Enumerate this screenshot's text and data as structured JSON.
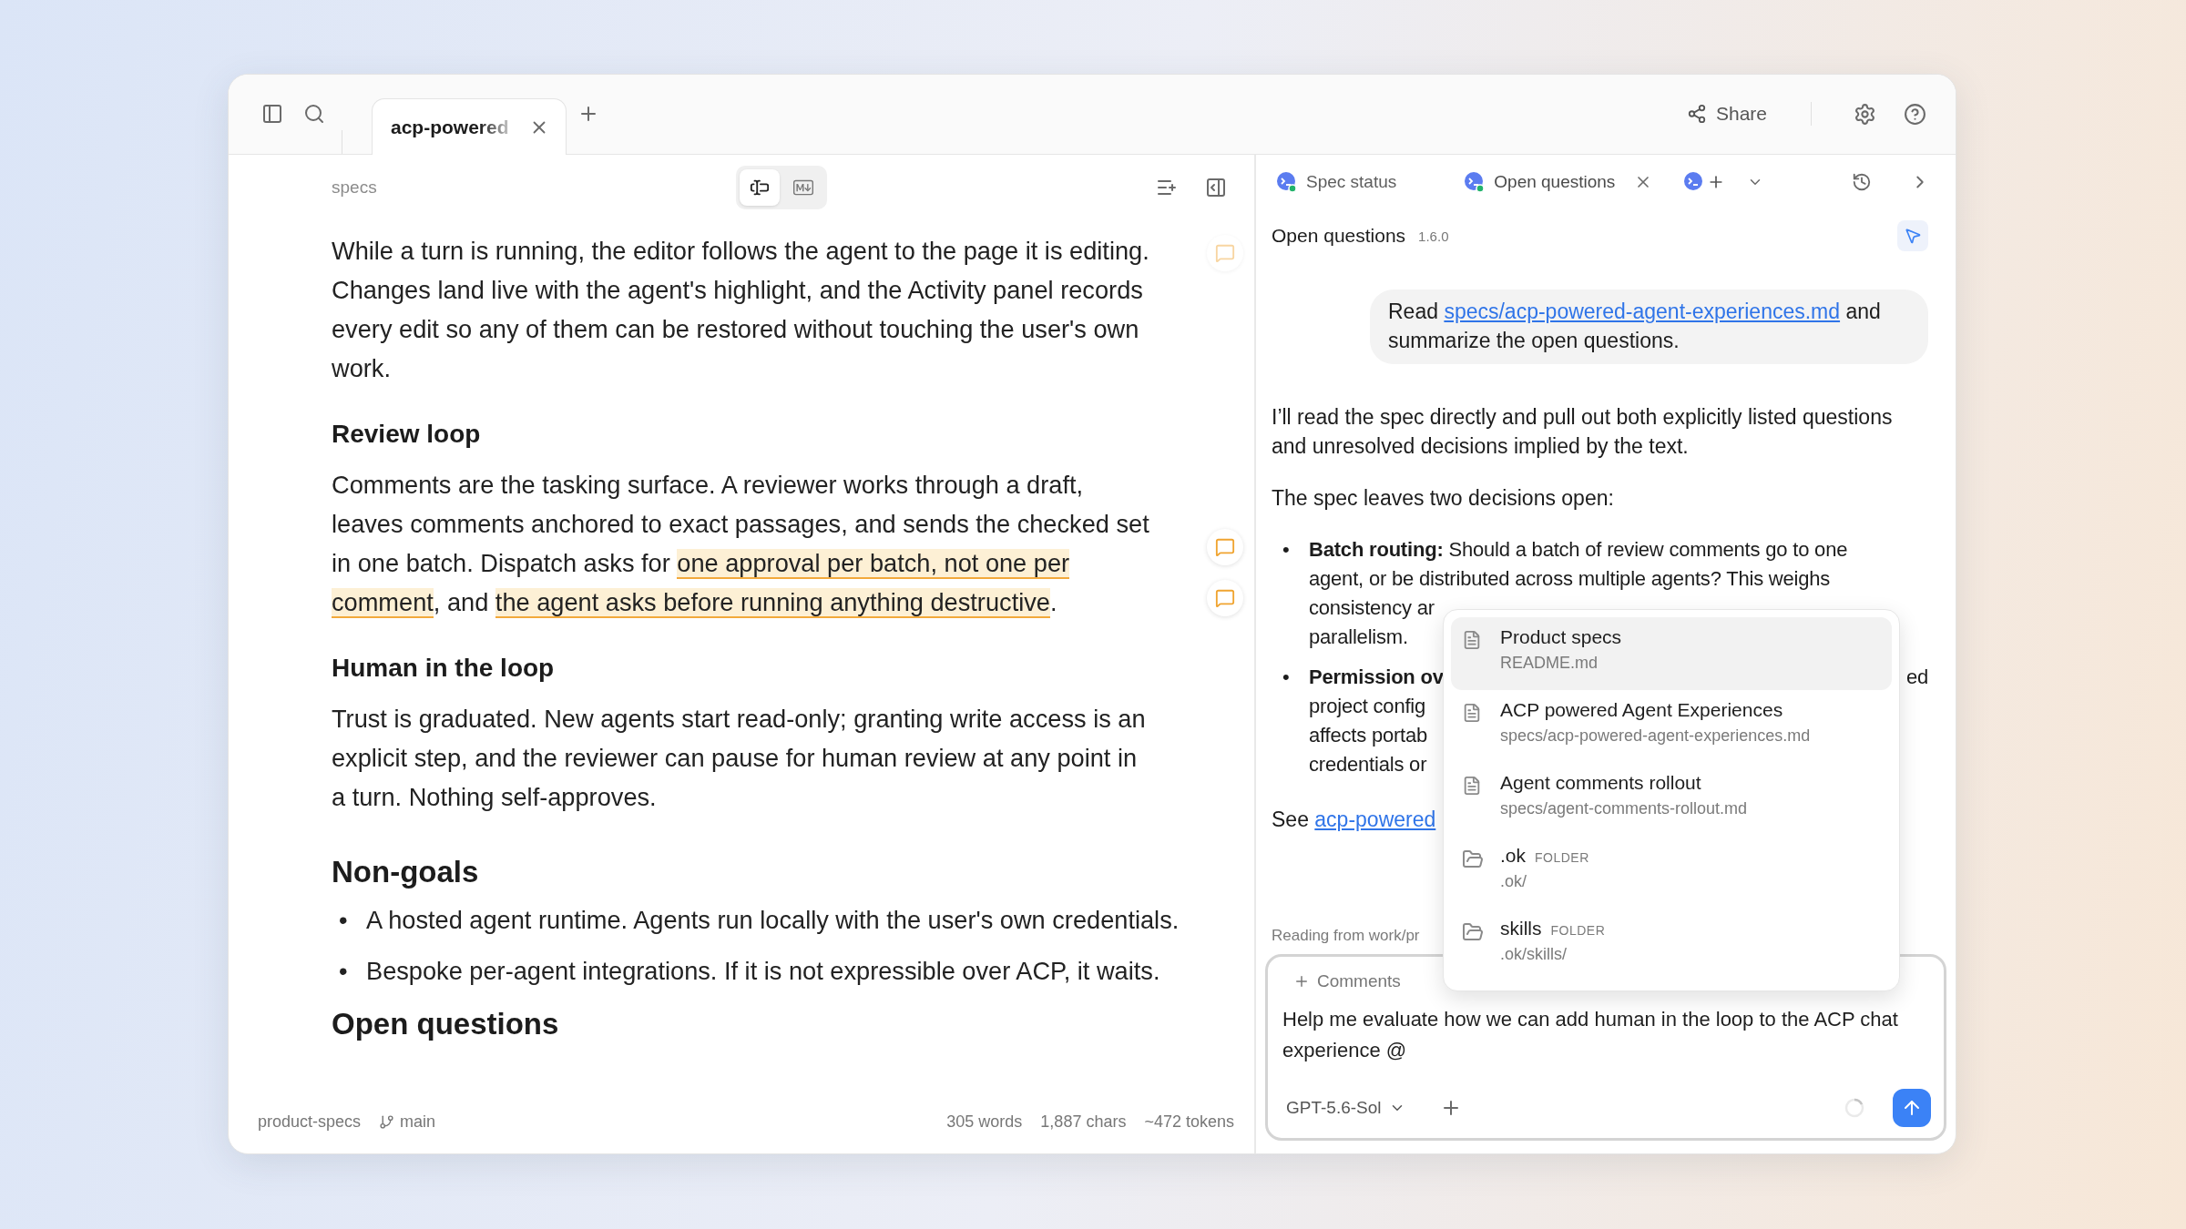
{
  "topbar": {
    "tabs": [
      {
        "label": "acp-powered",
        "selected": true
      }
    ],
    "share": "Share"
  },
  "editor": {
    "breadcrumb": "specs",
    "view_modes": [
      {
        "kind": "rich",
        "selected": true
      },
      {
        "kind": "markdown",
        "selected": false
      }
    ],
    "blocks": [
      {
        "kind": "paragraph",
        "segments": [
          {
            "text": "While a turn is running, the editor follows the agent to the page it is editing. Changes land live with the agent's highlight, and the Activity panel records every edit so any of them can be restored without touching the user's own work.",
            "highlighted": false
          }
        ],
        "comments": [
          {
            "resolved": true
          }
        ]
      },
      {
        "kind": "heading",
        "text": "Review loop"
      },
      {
        "kind": "paragraph",
        "segments": [
          {
            "text": "Comments are the tasking surface. A reviewer works through a draft, leaves comments anchored to exact passages, and sends the checked set in one batch. Dispatch asks for ",
            "highlighted": false
          },
          {
            "text": "one approval per batch, not one per comment",
            "highlighted": true
          },
          {
            "text": ", and ",
            "highlighted": false
          },
          {
            "text": "the agent asks before running anything destructive",
            "highlighted": true
          },
          {
            "text": ".",
            "highlighted": false
          }
        ],
        "comments": [
          {
            "resolved": false
          },
          {
            "resolved": false
          }
        ]
      },
      {
        "kind": "heading",
        "text": "Human in the loop"
      },
      {
        "kind": "paragraph",
        "segments": [
          {
            "text": "Trust is graduated. New agents start read-only; granting write access is an explicit step, and the reviewer can pause for human review at any point in a turn. Nothing self-approves.",
            "highlighted": false
          }
        ]
      },
      {
        "kind": "title",
        "text": "Non-goals"
      },
      {
        "kind": "list",
        "marker": "•",
        "items": [
          "A hosted agent runtime. Agents run locally with the user's own credentials.",
          "Bespoke per-agent integrations. If it is not expressible over ACP, it waits."
        ]
      },
      {
        "kind": "title",
        "text": "Open questions"
      }
    ]
  },
  "status_bar": {
    "project": "product-specs",
    "branch": "main",
    "words": "305 words",
    "chars": "1,887 chars",
    "tokens": "~472 tokens"
  },
  "chat": {
    "tabs": [
      {
        "label": "Spec status",
        "selected": false
      },
      {
        "label": "Open questions",
        "selected": true
      }
    ],
    "title": "Open questions",
    "version": "1.6.0",
    "messages": [
      {
        "kind": "user",
        "before": "Read ",
        "link": "specs/acp-powered-agent-experiences.md",
        "after": " and summarize the open questions."
      },
      {
        "kind": "paragraph",
        "text": "I’ll read the spec directly and pull out both explicitly listed questions and unresolved decisions implied by the text."
      },
      {
        "kind": "paragraph",
        "text": "The spec leaves two decisions open:"
      },
      {
        "kind": "bullets",
        "marker": "•",
        "items": [
          {
            "lines": [
              {
                "text": "**Batch routing:** Should a batch of review comments go to one"
              },
              {
                "text": "agent, or be distributed across multiple agents? This weighs"
              },
              {
                "text": "consistency ar"
              },
              {
                "text": "parallelism."
              }
            ]
          },
          {
            "lines": [
              {
                "text": "**Permission ov**",
                "end": "ed"
              },
              {
                "text": "project config"
              },
              {
                "text": "affects portab"
              },
              {
                "text": "credentials or"
              }
            ]
          }
        ]
      },
      {
        "kind": "link_line",
        "before": "See ",
        "link": "acp-powered"
      }
    ],
    "status": "Reading from work/pr",
    "composer": {
      "chip": "Comments",
      "value": "Help me evaluate how we can add human in the loop to the ACP chat experience @",
      "model": "GPT-5.6-Sol"
    },
    "mention_menu": {
      "items": [
        {
          "kind": "file",
          "title": "Product specs",
          "path": "README.md",
          "selected": true
        },
        {
          "kind": "file",
          "title": "ACP powered Agent Experiences",
          "path": "specs/acp-powered-agent-experiences.md",
          "selected": false
        },
        {
          "kind": "file",
          "title": "Agent comments rollout",
          "path": "specs/agent-comments-rollout.md",
          "selected": false
        },
        {
          "kind": "folder",
          "title": ".ok",
          "badge": "FOLDER",
          "path": ".ok/",
          "selected": false
        },
        {
          "kind": "folder",
          "title": "skills",
          "badge": "FOLDER",
          "path": ".ok/skills/",
          "selected": false
        }
      ]
    }
  }
}
